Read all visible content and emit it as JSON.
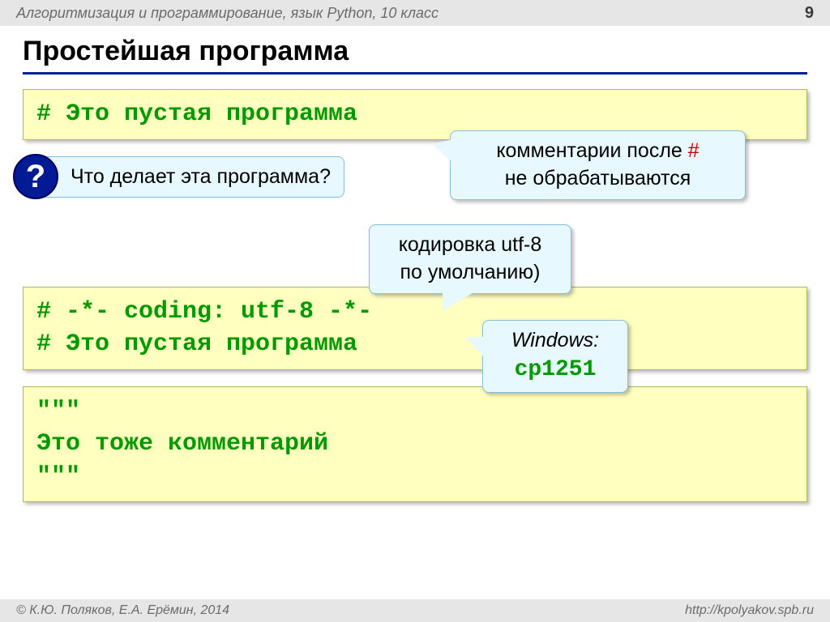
{
  "header": {
    "title": "Алгоритмизация и программирование, язык Python, 10 класс",
    "page": "9"
  },
  "title": "Простейшая программа",
  "code1": {
    "line1": "# Это пустая программа"
  },
  "question": {
    "text": "Что делает эта программа?",
    "mark": "?"
  },
  "callout1": {
    "part1": "комментарии после ",
    "hash": "#",
    "part2": "не обрабатываются"
  },
  "callout2": {
    "line1": "кодировка utf-8",
    "line2": "по умолчанию)"
  },
  "callout3": {
    "line1": "Windows:",
    "line2": "cp1251"
  },
  "code2": {
    "line1": "# -*- coding: utf-8 -*-",
    "line2": "# Это пустая программа"
  },
  "code3": {
    "line1": "\"\"\"",
    "line2": "Это тоже комментарий",
    "line3": "\"\"\""
  },
  "footer": {
    "left": "© К.Ю. Поляков, Е.А. Ерёмин, 2014",
    "right": "http://kpolyakov.spb.ru"
  }
}
